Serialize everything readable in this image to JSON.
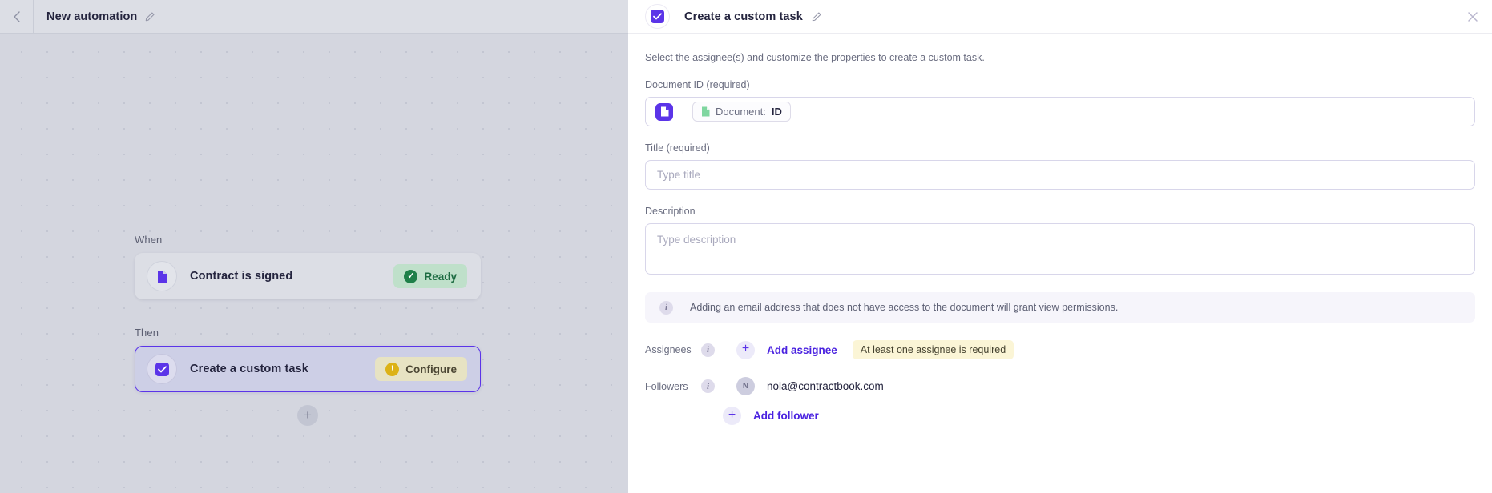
{
  "left": {
    "topbar": {
      "back_icon": "chevron-left-icon",
      "title": "New automation",
      "edit_icon": "pencil-icon"
    },
    "flow": {
      "when_label": "When",
      "then_label": "Then",
      "trigger": {
        "icon": "document-icon",
        "label": "Contract is signed",
        "status": "Ready",
        "status_icon": "check-circle-icon"
      },
      "action": {
        "icon": "checkbox-icon",
        "label": "Create a custom task",
        "status": "Configure",
        "status_icon": "alert-circle-icon"
      },
      "add_step_icon": "plus-icon"
    }
  },
  "panel": {
    "header": {
      "avatar_icon": "checkbox-icon",
      "title": "Create a custom task",
      "edit_icon": "pencil-icon",
      "close_icon": "close-icon"
    },
    "intro": "Select the assignee(s) and customize the properties to create a custom task.",
    "document_id": {
      "label": "Document ID (required)",
      "prefix_icon": "document-icon",
      "token_icon": "document-icon",
      "token_key": "Document:",
      "token_value": "ID"
    },
    "title_field": {
      "label": "Title (required)",
      "value": "",
      "placeholder": "Type title"
    },
    "description_field": {
      "label": "Description",
      "value": "",
      "placeholder": "Type description"
    },
    "info_banner": {
      "icon": "info-icon",
      "text": "Adding an email address that does not have access to the document will grant view permissions."
    },
    "assignees": {
      "label": "Assignees",
      "info_icon": "info-icon",
      "add_icon": "plus-icon",
      "add_label": "Add assignee",
      "warning": "At least one assignee is required"
    },
    "followers": {
      "label": "Followers",
      "info_icon": "info-icon",
      "person_initial": "N",
      "person_email": "nola@contractbook.com",
      "add_icon": "plus-icon",
      "add_label": "Add follower"
    }
  },
  "colors": {
    "accent": "#5b34e8",
    "link": "#4a22e0",
    "ready_bg": "#bfe0ca",
    "ready_fg": "#1c6b41",
    "configure_bg": "#e7e3c3",
    "warning_bg": "#fbf5d6",
    "canvas_bg": "#d4d6df"
  }
}
